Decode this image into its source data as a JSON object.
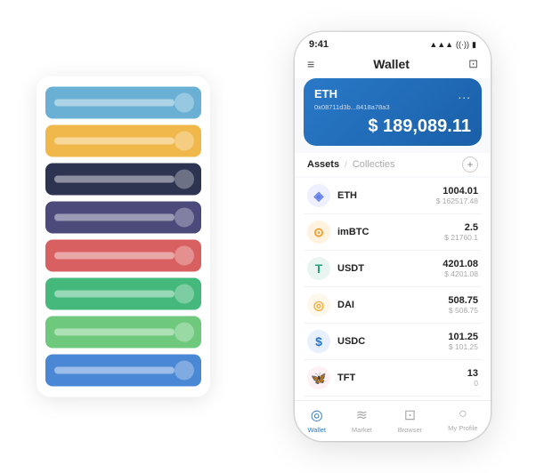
{
  "scene": {
    "back_panel": {
      "cards": [
        {
          "color": "#6ab0d4",
          "label": "Blue Light Card"
        },
        {
          "color": "#f0b84a",
          "label": "Yellow Card"
        },
        {
          "color": "#2d3452",
          "label": "Dark Blue Card"
        },
        {
          "color": "#4b4a7a",
          "label": "Purple Card"
        },
        {
          "color": "#d96060",
          "label": "Red Card"
        },
        {
          "color": "#45b87c",
          "label": "Green Card"
        },
        {
          "color": "#6ec97d",
          "label": "Light Green Card"
        },
        {
          "color": "#4a87d4",
          "label": "Blue Card"
        }
      ]
    },
    "phone": {
      "status_bar": {
        "time": "9:41",
        "icons": "▲ ◀ 🔋"
      },
      "header": {
        "menu_icon": "≡",
        "title": "Wallet",
        "expand_icon": "⊡"
      },
      "eth_card": {
        "coin": "ETH",
        "address": "0x08711d3b...8418a78a3",
        "balance": "$ 189,089.11",
        "more": "..."
      },
      "assets_tabs": {
        "tab_active": "Assets",
        "tab_inactive": "Collecties",
        "separator": "/"
      },
      "assets": [
        {
          "name": "ETH",
          "amount": "1004.01",
          "usd": "$ 162517.48",
          "icon": "◈",
          "icon_color": "#627eea",
          "icon_bg": "#eef0ff"
        },
        {
          "name": "imBTC",
          "amount": "2.5",
          "usd": "$ 21760.1",
          "icon": "⊙",
          "icon_color": "#f7931a",
          "icon_bg": "#fff3e0"
        },
        {
          "name": "USDT",
          "amount": "4201.08",
          "usd": "$ 4201.08",
          "icon": "T",
          "icon_color": "#26a17b",
          "icon_bg": "#e8f5f1"
        },
        {
          "name": "DAI",
          "amount": "508.75",
          "usd": "$ 508.75",
          "icon": "◎",
          "icon_color": "#f5ac37",
          "icon_bg": "#fef8ec"
        },
        {
          "name": "USDC",
          "amount": "101.25",
          "usd": "$ 101.25",
          "icon": "$",
          "icon_color": "#2775ca",
          "icon_bg": "#e8f0fc"
        },
        {
          "name": "TFT",
          "amount": "13",
          "usd": "0",
          "icon": "🦋",
          "icon_color": "#e96c8a",
          "icon_bg": "#fff0f4"
        }
      ],
      "bottom_nav": [
        {
          "label": "Wallet",
          "icon": "◎",
          "active": true
        },
        {
          "label": "Market",
          "icon": "📈",
          "active": false
        },
        {
          "label": "Browser",
          "icon": "👤",
          "active": false
        },
        {
          "label": "My Profile",
          "icon": "👤",
          "active": false
        }
      ]
    }
  }
}
